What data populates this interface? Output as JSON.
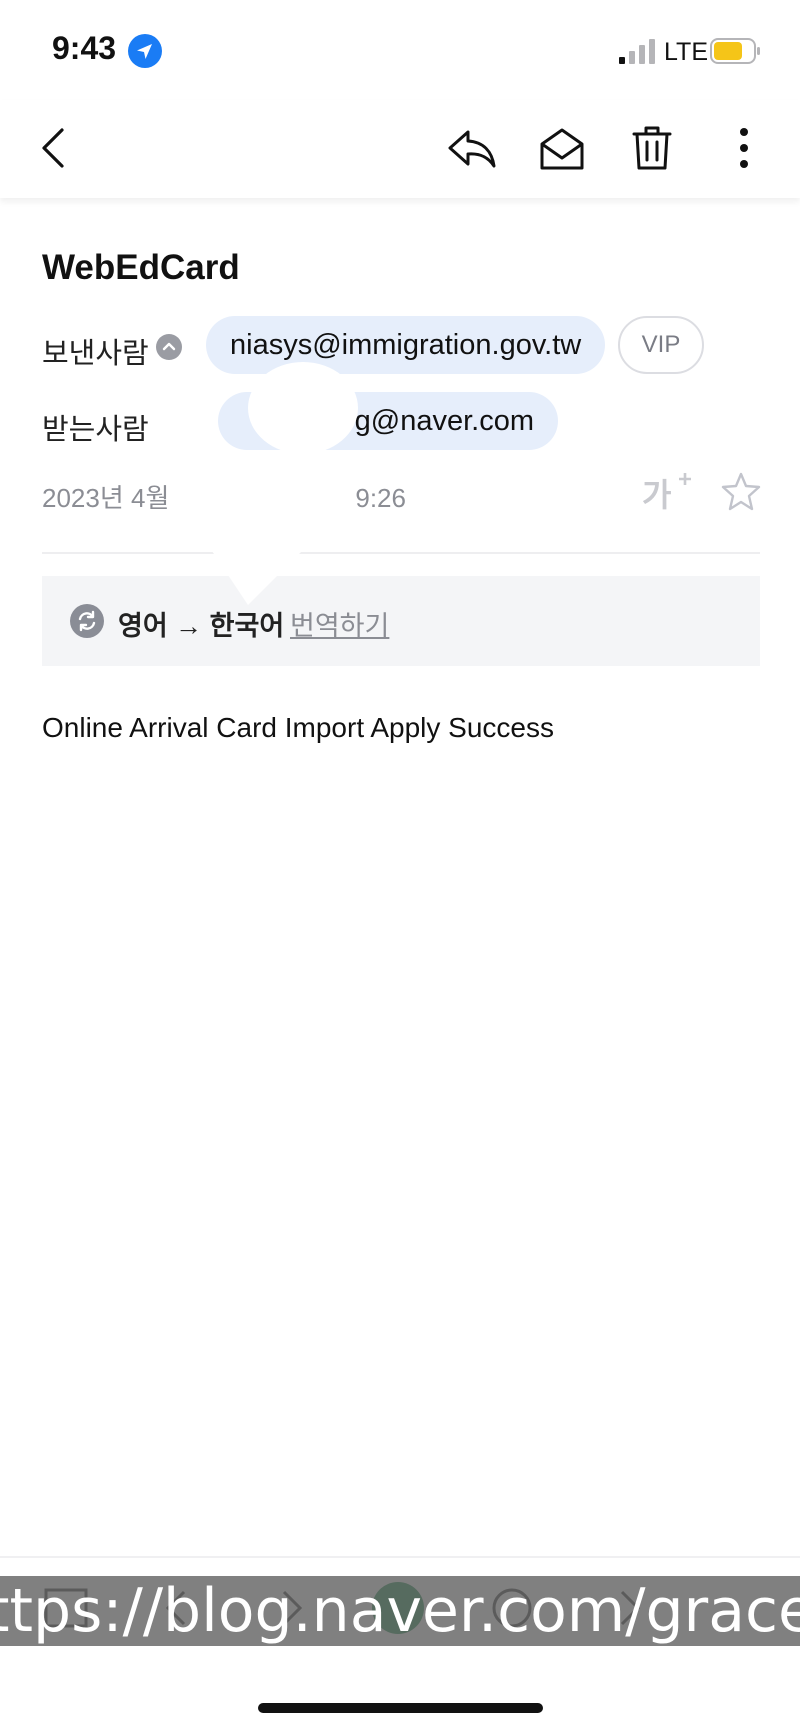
{
  "status_bar": {
    "time": "9:43",
    "network": "LTE"
  },
  "toolbar": {
    "back": "chevron-left-icon",
    "reply": "reply-icon",
    "mark_read": "envelope-open-icon",
    "delete": "trash-icon",
    "more": "more-vertical-icon"
  },
  "mail": {
    "subject": "WebEdCard",
    "sender_label": "보낸사람",
    "sender_email": "niasys@immigration.gov.tw",
    "vip_label": "VIP",
    "recipient_label": "받는사람",
    "recipient_email_visible": "g@naver.com",
    "date_prefix": "2023년 4월",
    "date_suffix": "9:26",
    "font_size_label": "가",
    "body": "Online Arrival Card Import Apply Success"
  },
  "translate": {
    "lang_from_to": "영어 → 한국어",
    "action": "번역하기"
  },
  "watermark": "ttps://blog.naver.com/graceyang",
  "colors": {
    "chip_bg": "#e6eefb",
    "accent_blue": "#1a7cf5",
    "battery_yellow": "#f5c518",
    "muted_text": "#8b8d94"
  }
}
